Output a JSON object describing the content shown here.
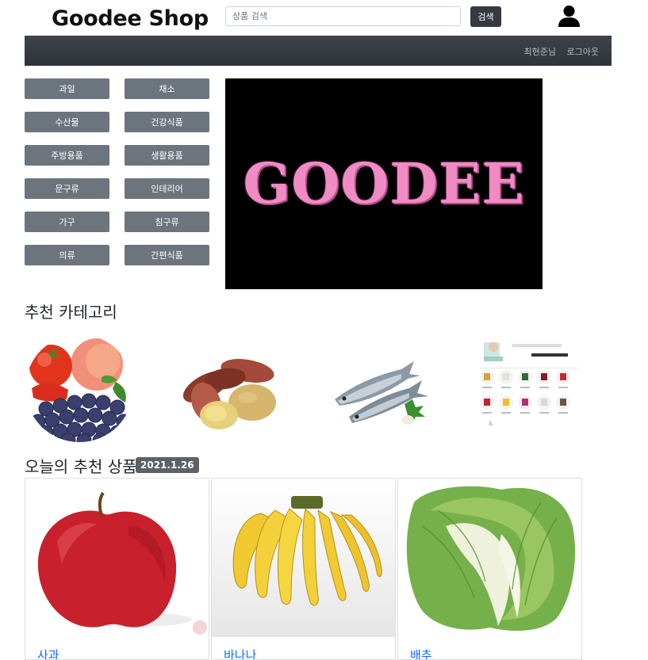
{
  "header": {
    "logo": "Goodee Shop",
    "search_placeholder": "상품 검색",
    "search_button": "검색"
  },
  "navbar": {
    "user": "최현준님",
    "logout": "로그아웃"
  },
  "categories": [
    "과일",
    "채소",
    "수산물",
    "건강식품",
    "주방용품",
    "생활용품",
    "문구류",
    "인테리어",
    "가구",
    "침구류",
    "의류",
    "간편식품"
  ],
  "banner": {
    "text": "GOODEE"
  },
  "recommended_categories": {
    "title": "추천 카테고리",
    "items": [
      "fruit-category-image",
      "sweet-potato-category-image",
      "fish-category-image",
      "health-food-category-image"
    ]
  },
  "today_products": {
    "title": "오늘의 추천 상품",
    "date": "2021.1.26",
    "products": [
      {
        "name": "사과",
        "image": "apple-image"
      },
      {
        "name": "바나나",
        "image": "banana-image"
      },
      {
        "name": "배추",
        "image": "cabbage-image"
      }
    ]
  }
}
